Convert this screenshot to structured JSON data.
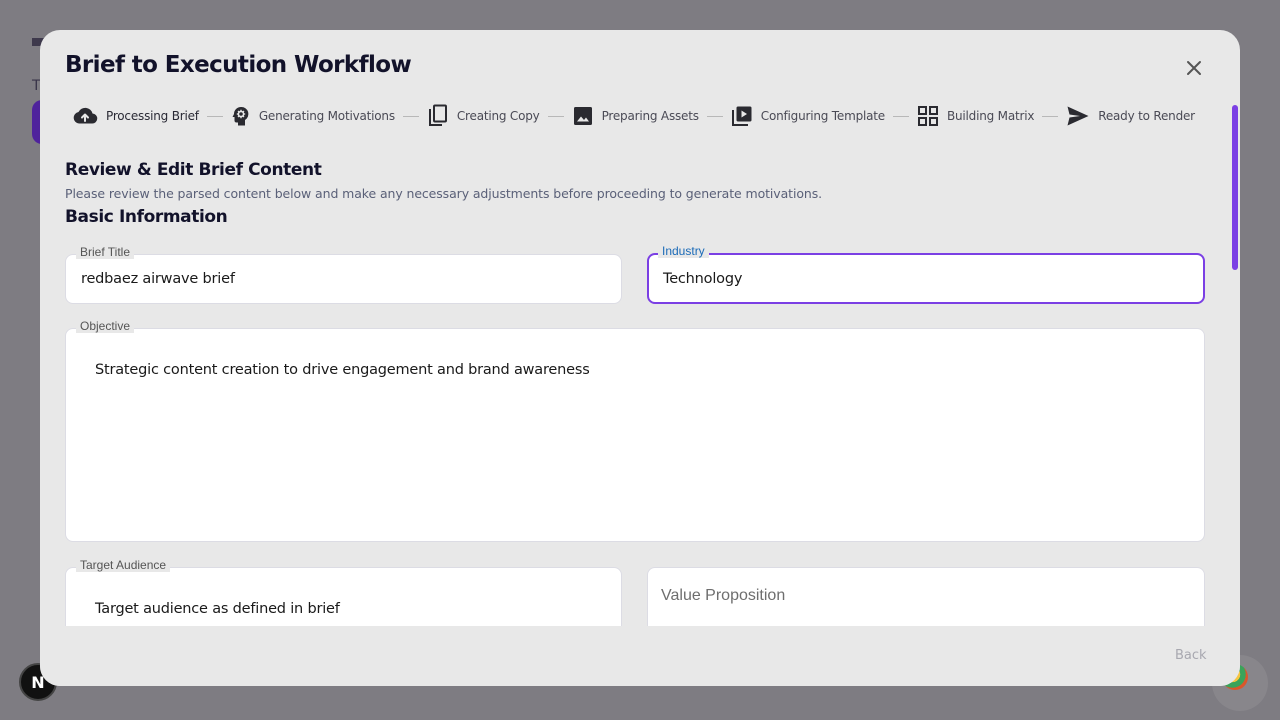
{
  "background": {
    "title_fragment": "T",
    "badge_letter": "N"
  },
  "modal": {
    "title": "Brief to Execution Workflow",
    "close_icon": "close-icon"
  },
  "stepper": {
    "steps": [
      {
        "label": "Processing Brief",
        "icon": "cloud-upload-icon",
        "active": true
      },
      {
        "label": "Generating Motivations",
        "icon": "psychology-icon",
        "active": false
      },
      {
        "label": "Creating Copy",
        "icon": "copy-icon",
        "active": false
      },
      {
        "label": "Preparing Assets",
        "icon": "image-icon",
        "active": false
      },
      {
        "label": "Configuring Template",
        "icon": "video-library-icon",
        "active": false
      },
      {
        "label": "Building Matrix",
        "icon": "grid-icon",
        "active": false
      },
      {
        "label": "Ready to Render",
        "icon": "send-icon",
        "active": false
      }
    ]
  },
  "content": {
    "heading": "Review & Edit Brief Content",
    "description": "Please review the parsed content below and make any necessary adjustments before proceeding to generate motivations.",
    "basic_info_heading": "Basic Information",
    "fields": {
      "brief_title": {
        "label": "Brief Title",
        "value": "redbaez airwave brief"
      },
      "industry": {
        "label": "Industry",
        "value": "Technology"
      },
      "objective": {
        "label": "Objective",
        "value": "Strategic content creation to drive engagement and brand awareness"
      },
      "target_audience": {
        "label": "Target Audience",
        "value": "Target audience as defined in brief"
      },
      "value_proposition": {
        "placeholder": "Value Proposition",
        "value": ""
      }
    }
  },
  "footer": {
    "back_label": "Back"
  },
  "colors": {
    "accent": "#7b3fe4",
    "focus_label": "#1b6bb8",
    "overlay": "#7e7c82"
  }
}
